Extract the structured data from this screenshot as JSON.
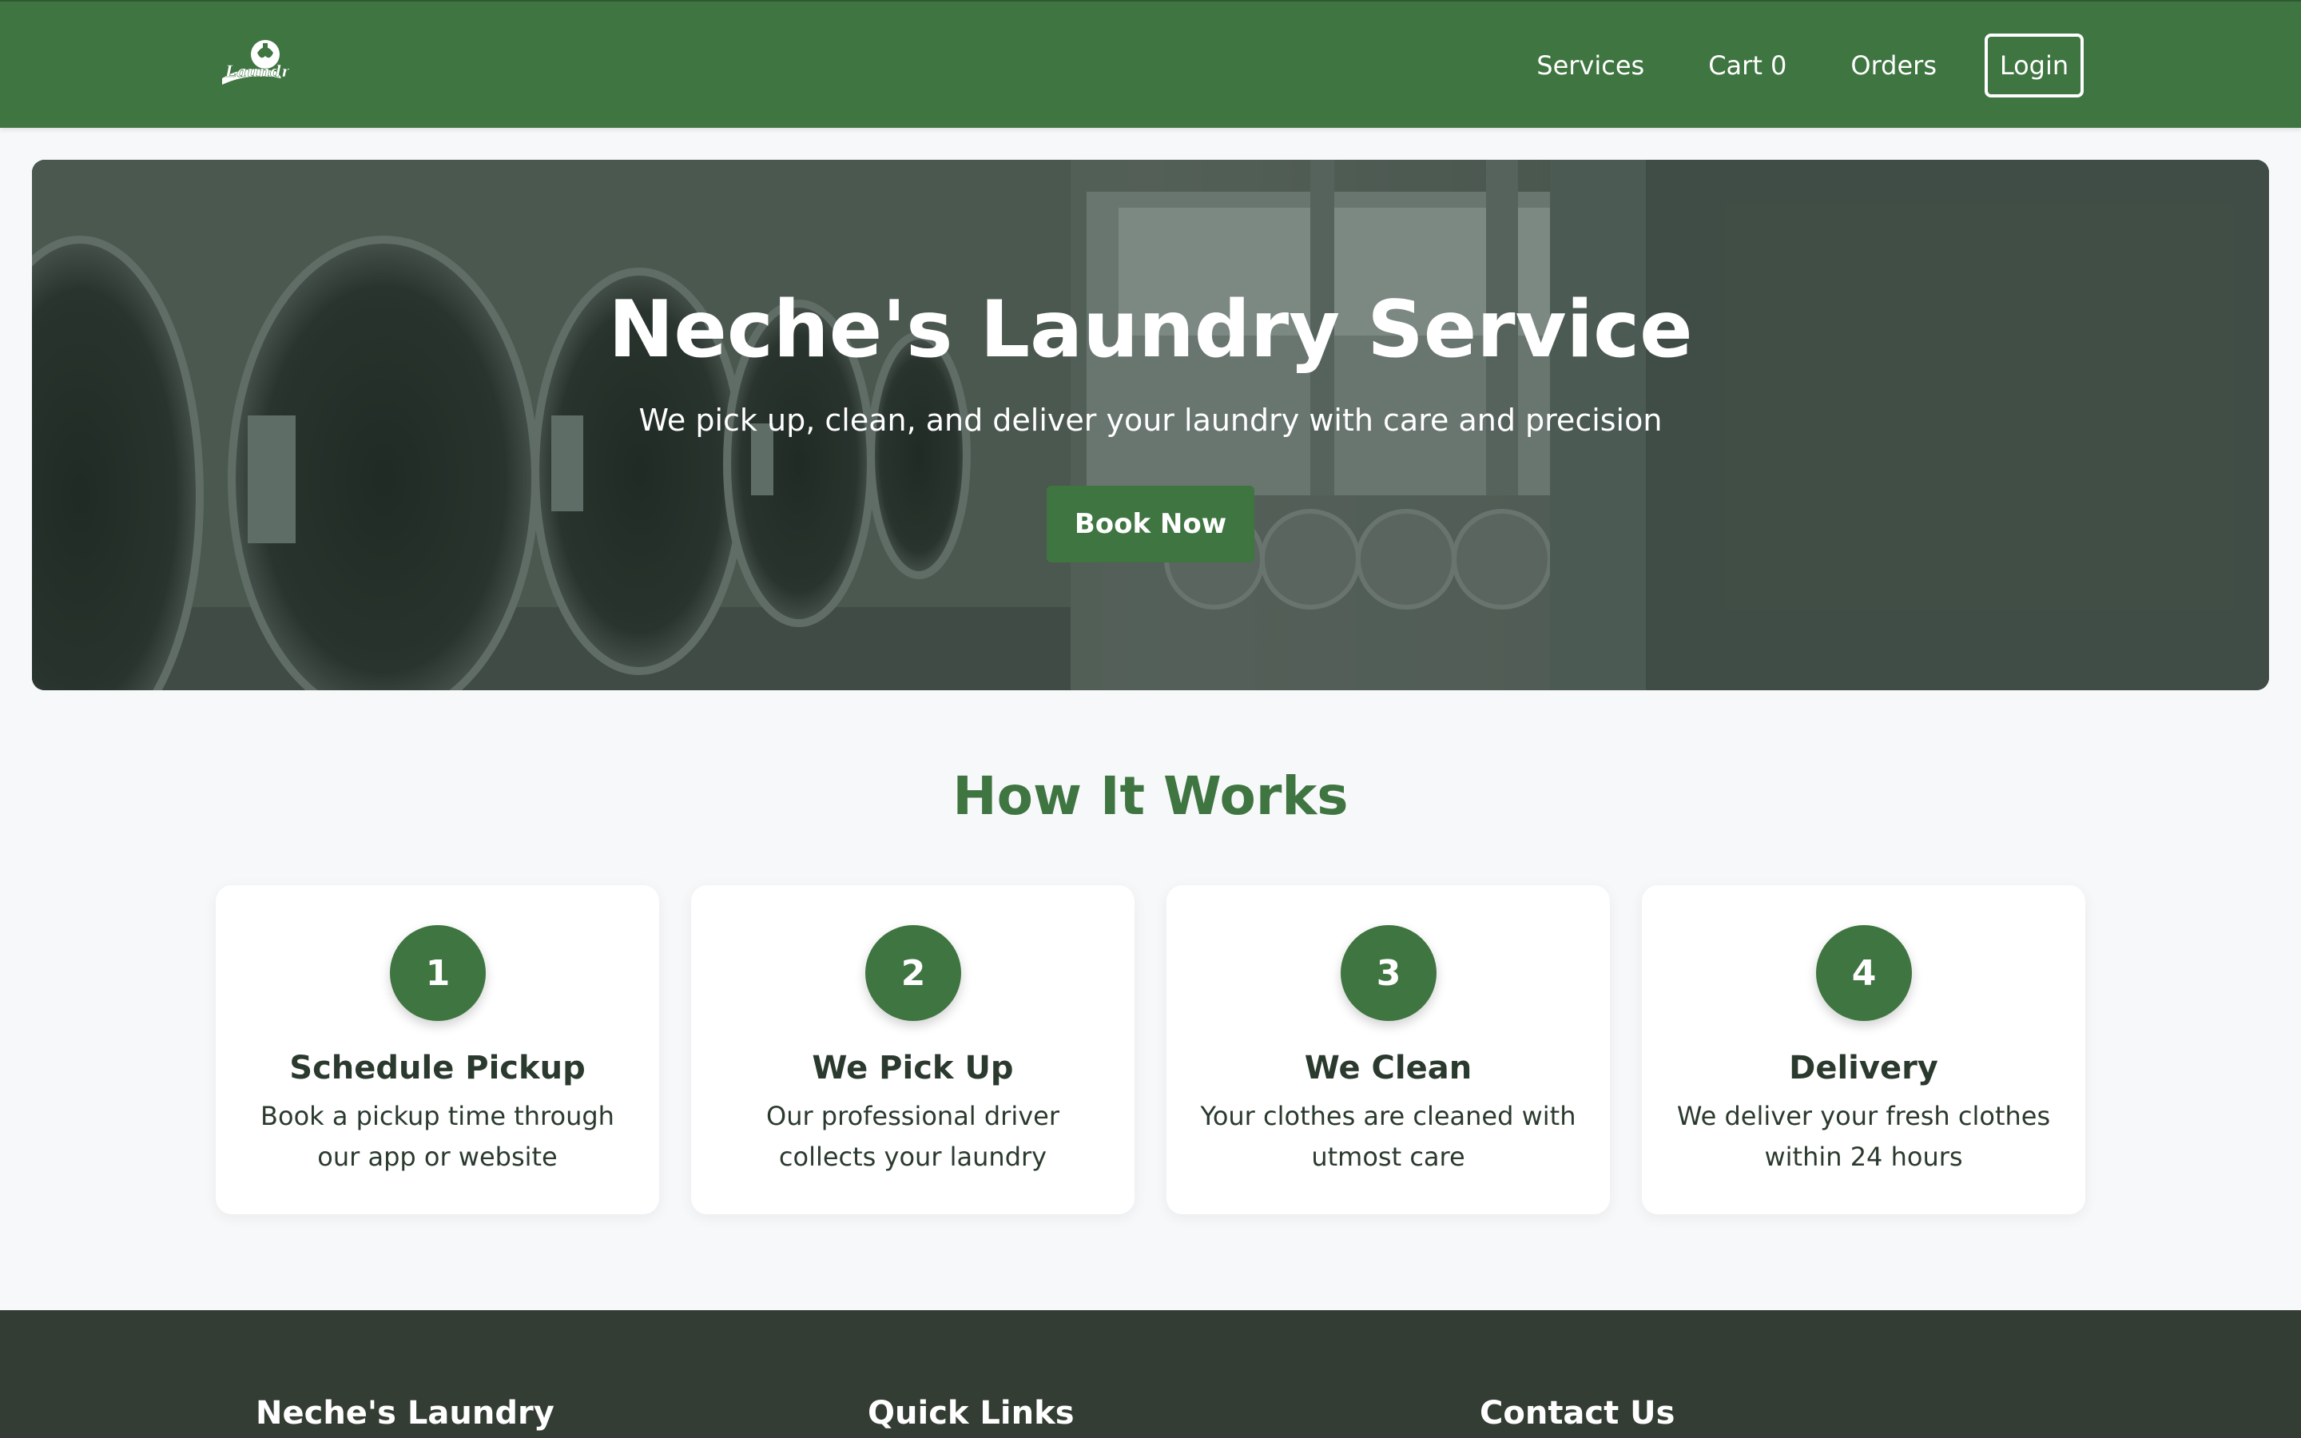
{
  "navbar": {
    "logo_text": "Laundry",
    "links": [
      "Services",
      "Cart 0",
      "Orders"
    ],
    "login_label": "Login"
  },
  "hero": {
    "title": "Neche's Laundry Service",
    "subtitle": "We pick up, clean, and deliver your laundry with care and precision",
    "cta_label": "Book Now"
  },
  "how_it_works": {
    "title": "How It Works",
    "steps": [
      {
        "number": "1",
        "title": "Schedule Pickup",
        "description": "Book a pickup time through our app or website"
      },
      {
        "number": "2",
        "title": "We Pick Up",
        "description": "Our professional driver collects your laundry"
      },
      {
        "number": "3",
        "title": "We Clean",
        "description": "Your clothes are cleaned with utmost care"
      },
      {
        "number": "4",
        "title": "Delivery",
        "description": "We deliver your fresh clothes within 24 hours"
      }
    ]
  },
  "footer": {
    "columns": [
      "Neche's Laundry",
      "Quick Links",
      "Contact Us"
    ]
  },
  "colors": {
    "brand_green": "#3f7541",
    "footer_dark": "#333d33",
    "page_bg": "#f7f8fa"
  }
}
